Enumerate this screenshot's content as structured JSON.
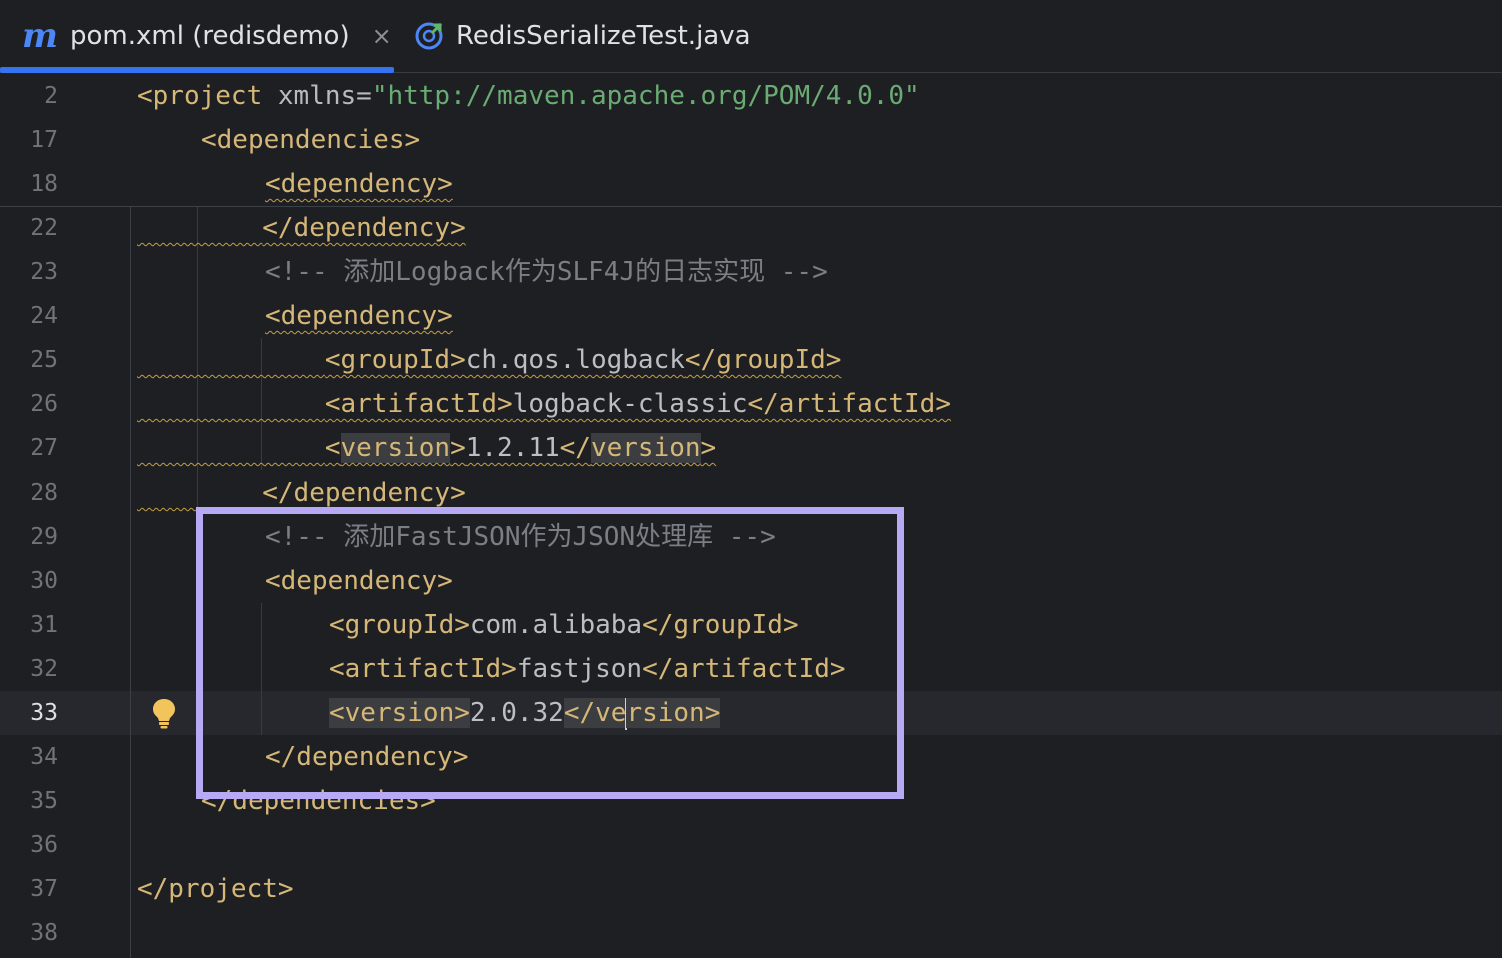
{
  "tabs": [
    {
      "icon": "maven-icon",
      "icon_glyph": "m",
      "label": "pom.xml (redisdemo)",
      "close": "×",
      "active": true
    },
    {
      "icon": "java-test-class-icon",
      "label": "RedisSerializeTest.java",
      "active": false
    }
  ],
  "editor": {
    "current_line": "33",
    "lines": [
      {
        "n": "2",
        "t": {
          "a": "<project",
          "b": " xmlns=",
          "c": "\"http://maven.apache.org/POM/4.0.0\""
        }
      },
      {
        "n": "17",
        "t": "<dependencies>"
      },
      {
        "n": "18",
        "t": "<dependency>"
      },
      {
        "n": "22",
        "t": "</dependency>"
      },
      {
        "n": "23",
        "t": "<!-- 添加Logback作为SLF4J的日志实现 -->"
      },
      {
        "n": "24",
        "t": "<dependency>"
      },
      {
        "n": "25",
        "t": {
          "a": "<groupId>",
          "b": "ch.qos.logback",
          "c": "</groupId>"
        }
      },
      {
        "n": "26",
        "t": {
          "a": "<artifactId>",
          "b": "logback-classic",
          "c": "</artifactId>"
        }
      },
      {
        "n": "27",
        "t": {
          "a": "<",
          "b": "version",
          "c": ">",
          "d": "1.2.11",
          "e": "</",
          "f": "version",
          "g": ">"
        }
      },
      {
        "n": "28",
        "t": "</dependency>"
      },
      {
        "n": "29",
        "t": "<!-- 添加FastJSON作为JSON处理库 -->"
      },
      {
        "n": "30",
        "t": "<dependency>"
      },
      {
        "n": "31",
        "t": {
          "a": "<groupId>",
          "b": "com.alibaba",
          "c": "</groupId>"
        }
      },
      {
        "n": "32",
        "t": {
          "a": "<artifactId>",
          "b": "fastjson",
          "c": "</artifactId>"
        }
      },
      {
        "n": "33",
        "t": {
          "a": "<version>",
          "b": "2.0.32",
          "c": "</ve",
          "d": "rsion>"
        }
      },
      {
        "n": "34",
        "t": "</dependency>"
      },
      {
        "n": "35",
        "t": "</dependencies>"
      },
      {
        "n": "36",
        "t": ""
      },
      {
        "n": "37",
        "t": "</project>"
      },
      {
        "n": "38",
        "t": ""
      }
    ]
  },
  "colors": {
    "background": "#1e1f22",
    "tag": "#d5b778",
    "string": "#6aab73",
    "comment": "#7a7e85",
    "accent": "#3574f0",
    "highlight_box": "#b8a9f4",
    "warning_underline": "#c3a042"
  },
  "icons": {
    "intention": "lightbulb-icon",
    "close": "close-icon"
  }
}
